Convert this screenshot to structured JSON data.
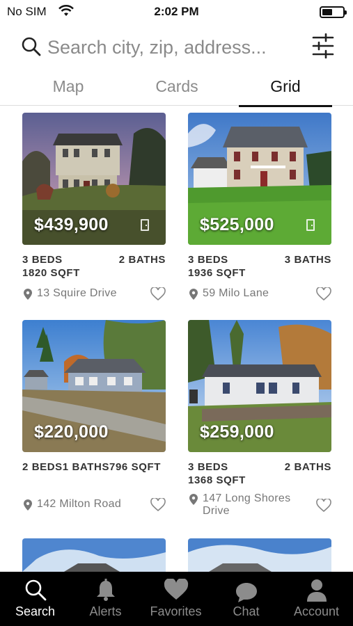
{
  "status_bar": {
    "carrier": "No SIM",
    "time": "2:02 PM"
  },
  "search": {
    "placeholder": "Search city, zip, address..."
  },
  "view_tabs": [
    {
      "label": "Map",
      "active": false
    },
    {
      "label": "Cards",
      "active": false
    },
    {
      "label": "Grid",
      "active": true
    }
  ],
  "listings": [
    {
      "price": "$439,900",
      "beds": "3 BEDS",
      "baths": "2 BATHS",
      "sqft": "1820 SQFT",
      "address": "13 Squire Drive",
      "favorited": false
    },
    {
      "price": "$525,000",
      "beds": "3 BEDS",
      "baths": "3 BATHS",
      "sqft": "1936 SQFT",
      "address": "59 Milo Lane",
      "favorited": false
    },
    {
      "price": "$220,000",
      "specs_combined": "2 BEDS1 BATHS796 SQFT",
      "address": "142 Milton Road",
      "favorited": false
    },
    {
      "price": "$259,000",
      "beds": "3 BEDS",
      "baths": "2 BATHS",
      "sqft": "1368 SQFT",
      "address": "147 Long Shores Drive",
      "favorited": false
    }
  ],
  "tab_bar": [
    {
      "label": "Search",
      "icon": "search-icon",
      "active": true
    },
    {
      "label": "Alerts",
      "icon": "bell-icon",
      "active": false
    },
    {
      "label": "Favorites",
      "icon": "heart-icon",
      "active": false
    },
    {
      "label": "Chat",
      "icon": "chat-bubble-icon",
      "active": false
    },
    {
      "label": "Account",
      "icon": "person-icon",
      "active": false
    }
  ],
  "colors": {
    "tab_bar_bg": "#000000",
    "tab_active": "#ffffff",
    "tab_inactive": "#8c8c8c",
    "accent_underline": "#111111"
  }
}
